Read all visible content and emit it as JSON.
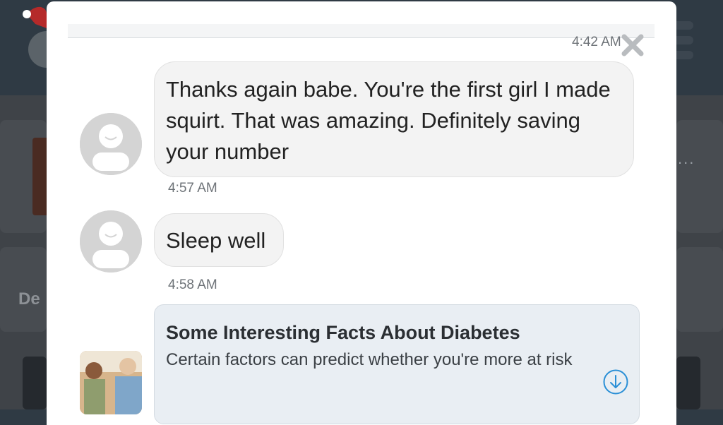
{
  "background": {
    "ellipsis": "...",
    "side_label": "De"
  },
  "conversation": {
    "top_timestamp": "4:42 AM",
    "messages": [
      {
        "text": "Thanks again babe. You're the first girl I made squirt. That was amazing. Definitely saving your number",
        "time": "4:57 AM"
      },
      {
        "text": "Sleep well",
        "time": "4:58 AM"
      }
    ],
    "article": {
      "title": "Some Interesting Facts About Diabetes",
      "description": "Certain factors can predict whether you're more at risk"
    }
  },
  "icons": {
    "close": "close-icon",
    "avatar": "default-avatar-icon",
    "download": "download-circle-icon",
    "menu": "hamburger-menu-icon"
  },
  "colors": {
    "accent": "#2a8fd6",
    "bubble": "#f3f3f3",
    "article_card": "#e9eef3"
  }
}
